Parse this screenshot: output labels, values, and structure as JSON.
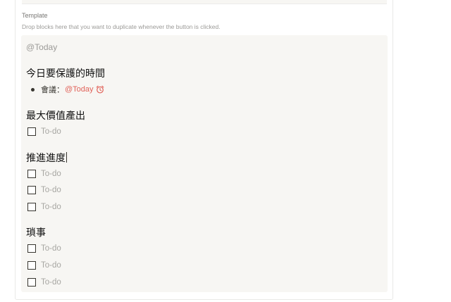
{
  "template": {
    "label": "Template",
    "hint": "Drop blocks here that you want to duplicate whenever the button is clicked."
  },
  "today_mention": "@Today",
  "sections": [
    {
      "heading": "今日要保護的時間"
    },
    {
      "heading": "最大價值產出"
    },
    {
      "heading": "推進進度"
    },
    {
      "heading": "瑣事"
    }
  ],
  "bullet": {
    "prefix": "會議：",
    "mention": "@Today",
    "icon": "alarm-clock-icon",
    "mention_color": "#e16259"
  },
  "todo_placeholder": "To-do"
}
